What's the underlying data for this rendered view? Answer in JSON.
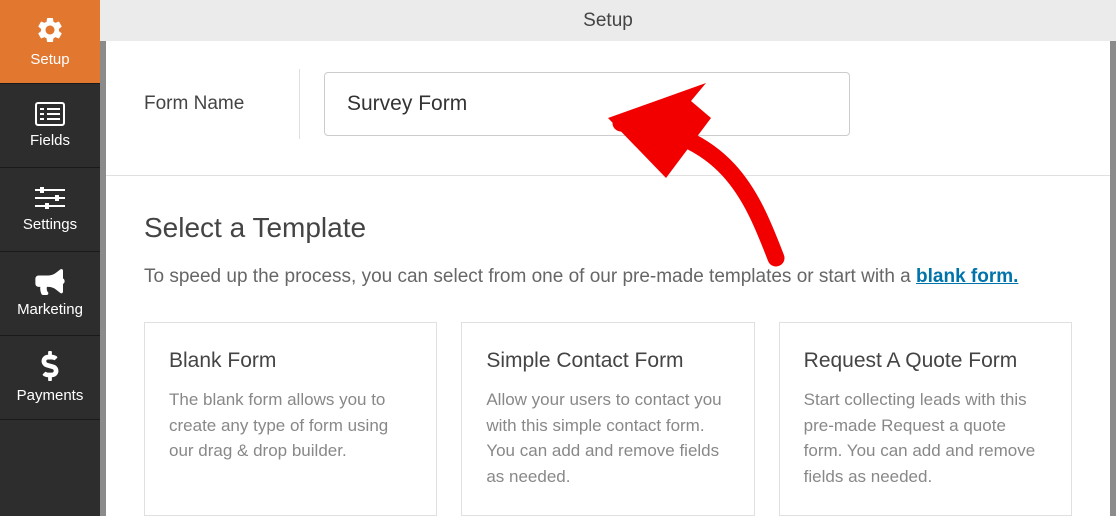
{
  "sidebar": {
    "items": [
      {
        "label": "Setup"
      },
      {
        "label": "Fields"
      },
      {
        "label": "Settings"
      },
      {
        "label": "Marketing"
      },
      {
        "label": "Payments"
      }
    ]
  },
  "topbar": {
    "title": "Setup"
  },
  "form_name": {
    "label": "Form Name",
    "value": "Survey Form"
  },
  "template_section": {
    "heading": "Select a Template",
    "intro_prefix": "To speed up the process, you can select from one of our pre-made templates or start with a ",
    "intro_link": "blank form."
  },
  "templates": [
    {
      "title": "Blank Form",
      "description": "The blank form allows you to create any type of form using our drag & drop builder."
    },
    {
      "title": "Simple Contact Form",
      "description": "Allow your users to contact you with this simple contact form. You can add and remove fields as needed."
    },
    {
      "title": "Request A Quote Form",
      "description": "Start collecting leads with this pre-made Request a quote form. You can add and remove fields as needed."
    }
  ]
}
